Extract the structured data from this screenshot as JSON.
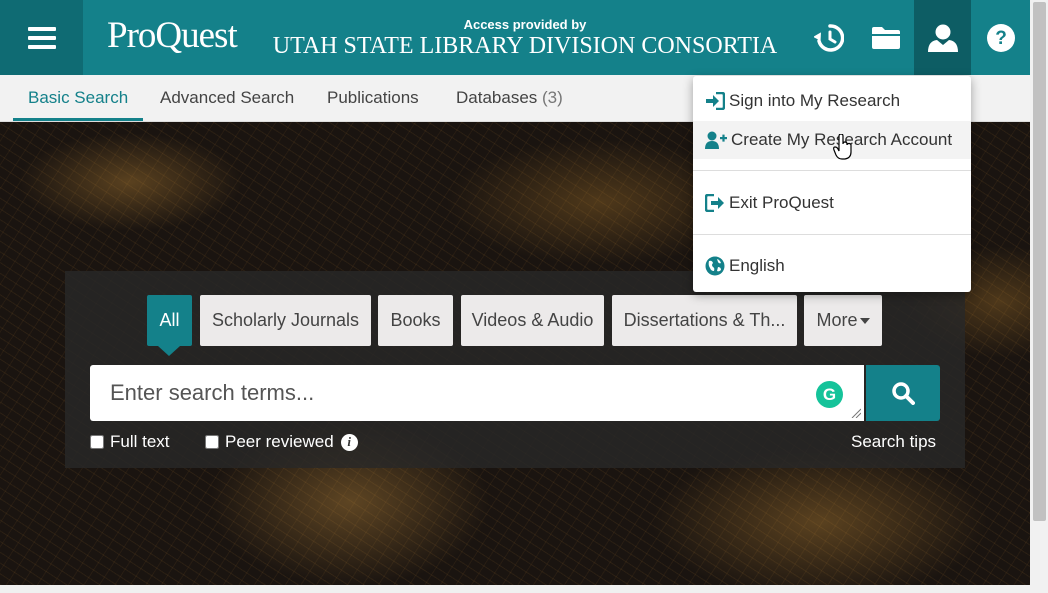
{
  "header": {
    "logo": "ProQuest",
    "access_label": "Access provided by",
    "institution": "UTAH STATE LIBRARY DIVISION CONSORTIA",
    "brand_color": "#14818a",
    "icons": [
      "menu-icon",
      "history-icon",
      "folder-icon",
      "user-icon",
      "help-icon"
    ]
  },
  "nav": {
    "tabs": [
      {
        "label": "Basic Search",
        "active": true
      },
      {
        "label": "Advanced Search"
      },
      {
        "label": "Publications"
      },
      {
        "label": "Databases",
        "count": "(3)"
      }
    ]
  },
  "search": {
    "filters": [
      {
        "label": "All",
        "active": true
      },
      {
        "label": "Scholarly Journals"
      },
      {
        "label": "Books"
      },
      {
        "label": "Videos & Audio"
      },
      {
        "label": "Dissertations & Th..."
      },
      {
        "label": "More"
      }
    ],
    "placeholder": "Enter search terms...",
    "grammarly": "G",
    "full_text_label": "Full text",
    "peer_reviewed_label": "Peer reviewed",
    "info": "i",
    "tips_label": "Search tips"
  },
  "user_menu": {
    "items": [
      {
        "label": "Sign into My Research",
        "icon": "sign-in-icon"
      },
      {
        "label": "Create My Research Account",
        "icon": "user-plus-icon",
        "hover": true
      },
      {
        "label": "Exit ProQuest",
        "icon": "sign-out-icon"
      },
      {
        "label": "English",
        "icon": "globe-icon"
      }
    ]
  }
}
